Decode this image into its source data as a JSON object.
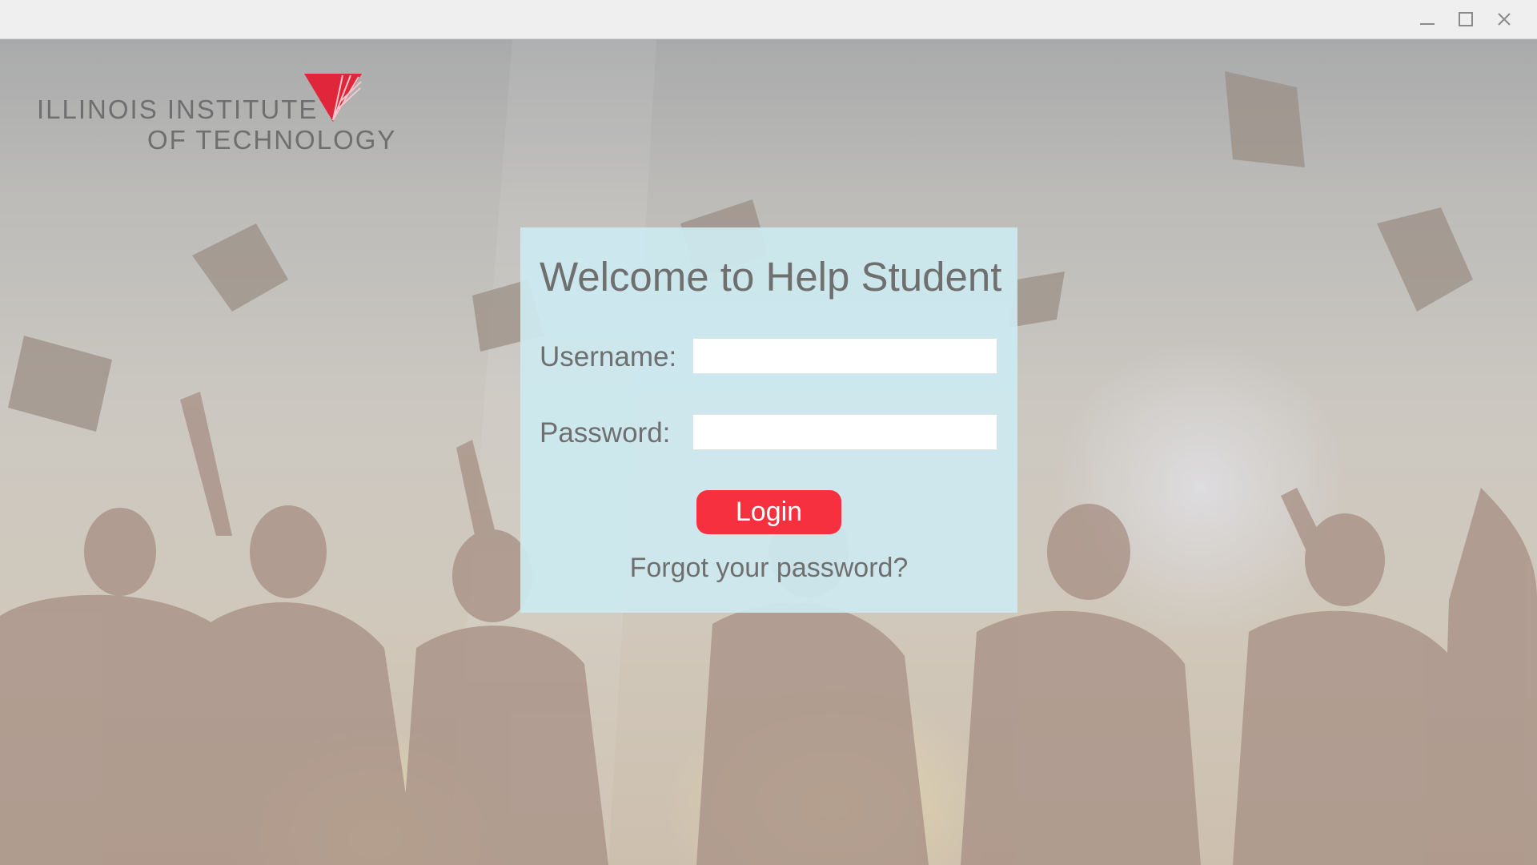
{
  "window": {
    "controls": [
      "minimize-icon",
      "maximize-icon",
      "close-icon"
    ]
  },
  "logo": {
    "line1": "ILLINOIS INSTITUTE",
    "line2": "OF TECHNOLOGY",
    "mark_color": "#e0263a"
  },
  "login": {
    "welcome": "Welcome to Help Student",
    "username_label": "Username:",
    "username_value": "",
    "password_label": "Password:",
    "password_value": "",
    "login_button": "Login",
    "forgot_link": "Forgot your password?"
  },
  "colors": {
    "panel": "#cce9f0",
    "login_button": "#f6303f",
    "text": "#6f6f6f"
  }
}
